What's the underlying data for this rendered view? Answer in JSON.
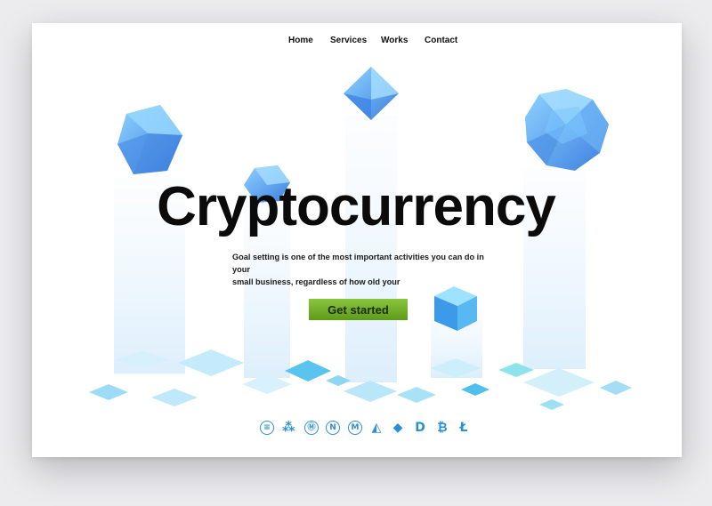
{
  "nav": {
    "home": "Home",
    "services": "Services",
    "works": "Works",
    "contact": "Contact"
  },
  "hero": {
    "title": "Cryptocurrency",
    "description_line1": "Goal setting is one of the most important activities you can do in your",
    "description_line2": "small business, regardless of how old your",
    "cta_label": "Get started"
  },
  "colors": {
    "accent_green": "#7fbf2e",
    "crystal_blue": "#5aa8f0",
    "tile_blue": "#7fd3f5",
    "beam_blue": "#d8ecfb"
  },
  "coin_icons": [
    {
      "name": "dash-coin-icon",
      "glyph": "≡"
    },
    {
      "name": "ripple-coin-icon",
      "glyph": "⁂"
    },
    {
      "name": "monero-coin-icon",
      "glyph": "Ⓜ"
    },
    {
      "name": "nem-coin-icon",
      "glyph": "N"
    },
    {
      "name": "monero-m-coin-icon",
      "glyph": "M"
    },
    {
      "name": "lisk-coin-icon",
      "glyph": "◭"
    },
    {
      "name": "ethereum-coin-icon",
      "glyph": "◆"
    },
    {
      "name": "dash-d-coin-icon",
      "glyph": "D"
    },
    {
      "name": "bitcoin-coin-icon",
      "glyph": "₿"
    },
    {
      "name": "litecoin-coin-icon",
      "glyph": "Ł"
    }
  ]
}
